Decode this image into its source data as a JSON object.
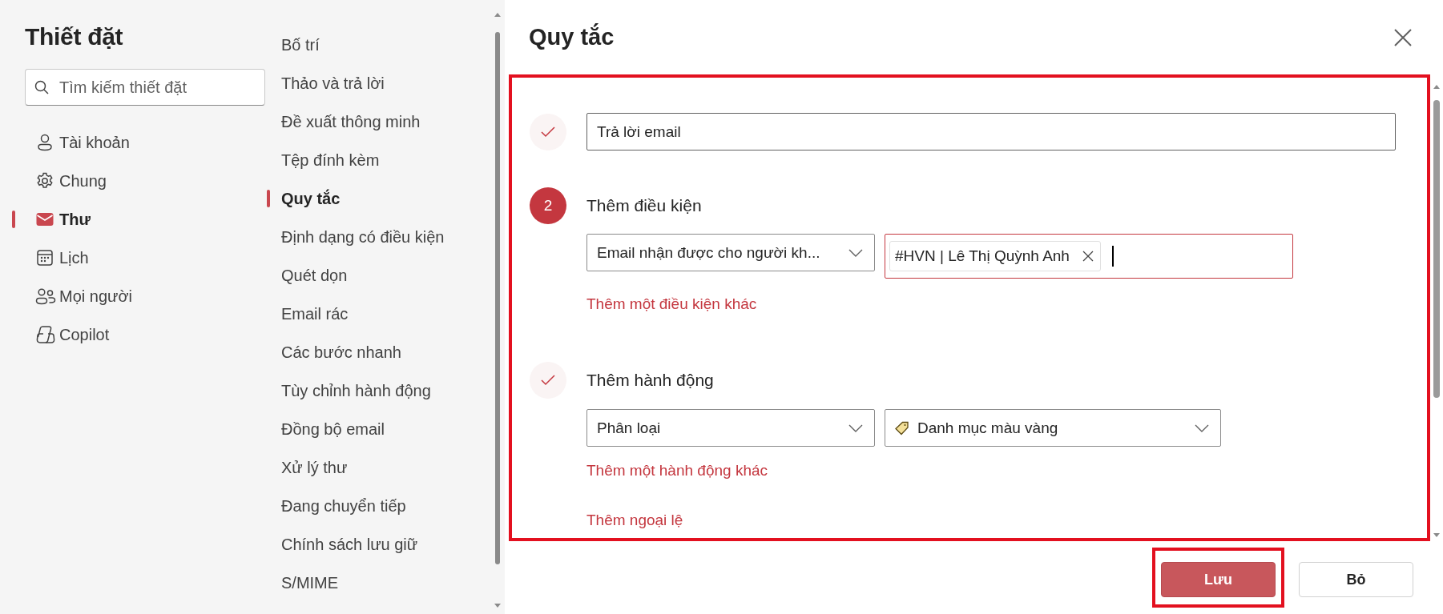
{
  "settings": {
    "title": "Thiết đặt",
    "search": {
      "placeholder": "Tìm kiếm thiết đặt"
    },
    "categories": [
      {
        "label": "Tài khoản",
        "selected": false
      },
      {
        "label": "Chung",
        "selected": false
      },
      {
        "label": "Thư",
        "selected": true
      },
      {
        "label": "Lịch",
        "selected": false
      },
      {
        "label": "Mọi người",
        "selected": false
      },
      {
        "label": "Copilot",
        "selected": false
      }
    ],
    "subcategories": [
      {
        "label": "Bố trí",
        "selected": false
      },
      {
        "label": "Thảo và trả lời",
        "selected": false
      },
      {
        "label": "Đề xuất thông minh",
        "selected": false
      },
      {
        "label": "Tệp đính kèm",
        "selected": false
      },
      {
        "label": "Quy tắc",
        "selected": true
      },
      {
        "label": "Định dạng có điều kiện",
        "selected": false
      },
      {
        "label": "Quét dọn",
        "selected": false
      },
      {
        "label": "Email rác",
        "selected": false
      },
      {
        "label": "Các bước nhanh",
        "selected": false
      },
      {
        "label": "Tùy chỉnh hành động",
        "selected": false
      },
      {
        "label": "Đồng bộ email",
        "selected": false
      },
      {
        "label": "Xử lý thư",
        "selected": false
      },
      {
        "label": "Đang chuyển tiếp",
        "selected": false
      },
      {
        "label": "Chính sách lưu giữ",
        "selected": false
      },
      {
        "label": "S/MIME",
        "selected": false
      }
    ]
  },
  "rule_editor": {
    "title": "Quy tắc",
    "highlighted": true,
    "steps": [
      {
        "completed": true,
        "controls": [
          {
            "kind": "text-input",
            "value": "Trả lời email"
          }
        ]
      },
      {
        "completed": false,
        "number": "2",
        "heading": "Thêm điều kiện",
        "controls": [
          {
            "kind": "dropdown",
            "value": "Email nhận được cho người kh..."
          },
          {
            "kind": "token-input",
            "tokens": [
              "#HVN | Lê Thị Quỳnh Anh"
            ],
            "focused": true
          }
        ],
        "links": [
          "Thêm một điều kiện khác"
        ]
      },
      {
        "completed": true,
        "heading": "Thêm hành động",
        "controls": [
          {
            "kind": "dropdown",
            "value": "Phân loại"
          },
          {
            "kind": "category-dropdown",
            "value": "Danh mục màu vàng"
          }
        ],
        "links": [
          "Thêm một hành động khác",
          "Thêm ngoại lệ"
        ]
      }
    ],
    "buttons": [
      {
        "label": "Lưu",
        "kind": "primary",
        "highlighted": true
      },
      {
        "label": "Bỏ",
        "kind": "secondary",
        "highlighted": false
      }
    ]
  }
}
